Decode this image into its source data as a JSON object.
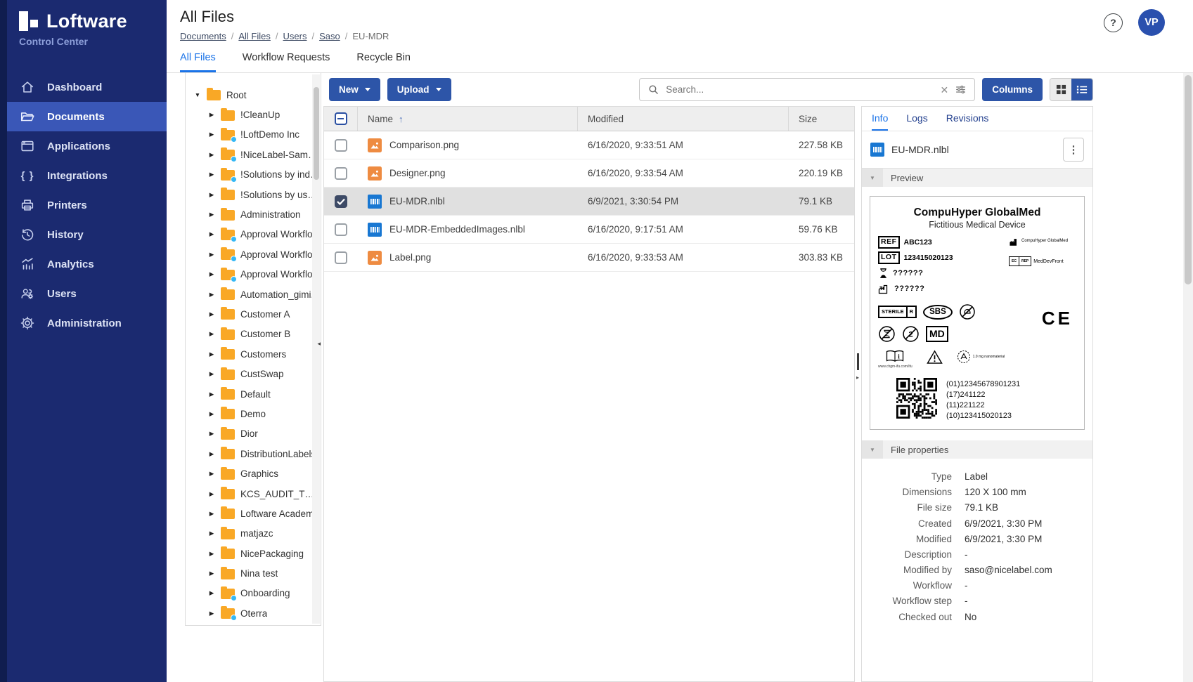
{
  "brand": {
    "name": "Loftware",
    "subtitle": "Control Center"
  },
  "topbar": {
    "title": "All Files",
    "help_label": "?",
    "avatar_initials": "VP"
  },
  "breadcrumb": {
    "separator": "/",
    "items": [
      {
        "label": "Documents",
        "link": true
      },
      {
        "label": "All Files",
        "link": true
      },
      {
        "label": "Users",
        "link": true
      },
      {
        "label": "Saso",
        "link": true
      },
      {
        "label": "EU-MDR",
        "link": false
      }
    ]
  },
  "nav_tabs": [
    {
      "label": "All Files",
      "active": true
    },
    {
      "label": "Workflow Requests",
      "active": false
    },
    {
      "label": "Recycle Bin",
      "active": false
    }
  ],
  "sidebar": {
    "items": [
      {
        "label": "Dashboard",
        "icon": "home",
        "active": false
      },
      {
        "label": "Documents",
        "icon": "folder-open",
        "active": true
      },
      {
        "label": "Applications",
        "icon": "app-window",
        "active": false
      },
      {
        "label": "Integrations",
        "icon": "braces",
        "active": false
      },
      {
        "label": "Printers",
        "icon": "printer",
        "active": false
      },
      {
        "label": "History",
        "icon": "history",
        "active": false
      },
      {
        "label": "Analytics",
        "icon": "analytics",
        "active": false
      },
      {
        "label": "Users",
        "icon": "users",
        "active": false
      },
      {
        "label": "Administration",
        "icon": "gear",
        "active": false
      }
    ]
  },
  "tree": {
    "root": {
      "label": "Root",
      "expanded": true
    },
    "children": [
      {
        "label": "!CleanUp",
        "badge": false
      },
      {
        "label": "!LoftDemo Inc",
        "badge": true
      },
      {
        "label": "!NiceLabel-Samples",
        "badge": true
      },
      {
        "label": "!Solutions by indu...",
        "badge": true
      },
      {
        "label": "!Solutions by use ...",
        "badge": false
      },
      {
        "label": "Administration",
        "badge": false
      },
      {
        "label": "Approval Workflo...",
        "badge": true
      },
      {
        "label": "Approval Workflo...",
        "badge": true
      },
      {
        "label": "Approval Workflo...",
        "badge": true
      },
      {
        "label": "Automation_gimi...",
        "badge": false
      },
      {
        "label": "Customer A",
        "badge": false
      },
      {
        "label": "Customer B",
        "badge": false
      },
      {
        "label": "Customers",
        "badge": false
      },
      {
        "label": "CustSwap",
        "badge": false
      },
      {
        "label": "Default",
        "badge": false
      },
      {
        "label": "Demo",
        "badge": false
      },
      {
        "label": "Dior",
        "badge": false
      },
      {
        "label": "DistributionLabels",
        "badge": false
      },
      {
        "label": "Graphics",
        "badge": false
      },
      {
        "label": "KCS_AUDIT_TOOL...",
        "badge": false
      },
      {
        "label": "Loftware Academy",
        "badge": false
      },
      {
        "label": "matjazc",
        "badge": false
      },
      {
        "label": "NicePackaging",
        "badge": false
      },
      {
        "label": "Nina test",
        "badge": false
      },
      {
        "label": "Onboarding",
        "badge": true
      },
      {
        "label": "Oterra",
        "badge": true
      }
    ]
  },
  "toolbar": {
    "new_label": "New",
    "upload_label": "Upload",
    "search_placeholder": "Search...",
    "columns_label": "Columns"
  },
  "table": {
    "columns": {
      "name": "Name",
      "modified": "Modified",
      "size": "Size",
      "sort_arrow": "↑"
    },
    "rows": [
      {
        "name": "Comparison.png",
        "kind": "image",
        "modified": "6/16/2020, 9:33:51 AM",
        "size": "227.58 KB",
        "selected": false
      },
      {
        "name": "Designer.png",
        "kind": "image",
        "modified": "6/16/2020, 9:33:54 AM",
        "size": "220.19 KB",
        "selected": false
      },
      {
        "name": "EU-MDR.nlbl",
        "kind": "label",
        "modified": "6/9/2021, 3:30:54 PM",
        "size": "79.1 KB",
        "selected": true
      },
      {
        "name": "EU-MDR-EmbeddedImages.nlbl",
        "kind": "label",
        "modified": "6/16/2020, 9:17:51 AM",
        "size": "59.76 KB",
        "selected": false
      },
      {
        "name": "Label.png",
        "kind": "image",
        "modified": "6/16/2020, 9:33:53 AM",
        "size": "303.83 KB",
        "selected": false
      }
    ]
  },
  "info_panel": {
    "tabs": [
      {
        "label": "Info",
        "active": true
      },
      {
        "label": "Logs",
        "active": false
      },
      {
        "label": "Revisions",
        "active": false
      }
    ],
    "file_name": "EU-MDR.nlbl",
    "preview_section": "Preview",
    "properties_section": "File properties",
    "label_preview": {
      "title": "CompuHyper GlobalMed",
      "subtitle": "Fictitious Medical Device",
      "ref_code": "REF",
      "ref_value": "ABC123",
      "lot_code": "LOT",
      "lot_value": "123415020123",
      "expiry_value": "??????",
      "mfg_value": "??????",
      "manufacturer_name": "CompuHyper GlobalMed",
      "ec_rep_top": "EC",
      "ec_rep_bottom": "REP",
      "ec_rep_value": "MedDevFront",
      "sterile_text": "STERILE",
      "sterile_method": "R",
      "sbs_text": "SBS",
      "md_text": "MD",
      "ce_text": "CE",
      "ifu_url": "www.chgm-ifu.com/ifu",
      "nano_text": "1.0 mg nanomaterial",
      "qr_lines": [
        "(01)12345678901231",
        "(17)241122",
        "(11)221122",
        "(10)123415020123"
      ]
    },
    "properties": [
      {
        "label": "Type",
        "value": "Label"
      },
      {
        "label": "Dimensions",
        "value": "120 X 100 mm"
      },
      {
        "label": "File size",
        "value": "79.1 KB"
      },
      {
        "label": "Created",
        "value": "6/9/2021, 3:30 PM"
      },
      {
        "label": "Modified",
        "value": "6/9/2021, 3:30 PM"
      },
      {
        "label": "Description",
        "value": "-"
      },
      {
        "label": "Modified by",
        "value": "saso@nicelabel.com"
      },
      {
        "label": "Workflow",
        "value": "-"
      },
      {
        "label": "Workflow step",
        "value": "-"
      },
      {
        "label": "Checked out",
        "value": "No"
      }
    ]
  },
  "colors": {
    "accent_blue": "#1a73e8",
    "button_blue": "#2d55a8",
    "sidebar_navy": "#1b2a70",
    "sidebar_active_blue": "#3a57b7",
    "folder_orange": "#f9a826",
    "badge_light_blue": "#35b8f5",
    "png_icon_orange": "#ee8b41",
    "nlbl_icon_blue": "#1877d2",
    "selected_row_gray": "#e0e0e0"
  }
}
